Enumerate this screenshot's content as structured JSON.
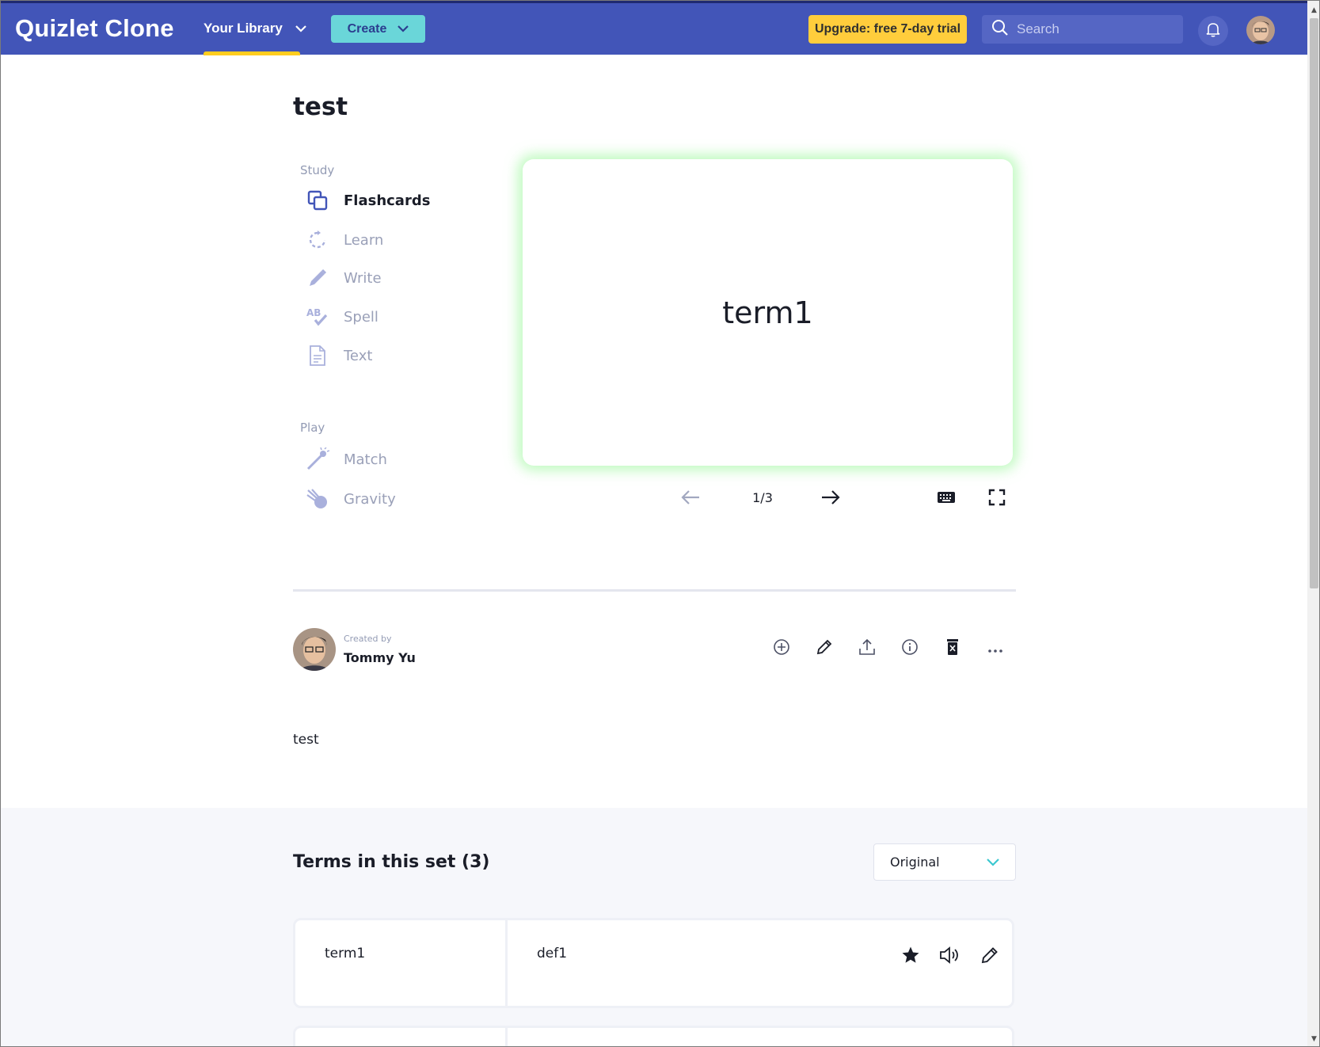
{
  "nav": {
    "logo": "Quizlet Clone",
    "library_label": "Your Library",
    "create_label": "Create",
    "upgrade_label": "Upgrade: free 7-day trial",
    "search_placeholder": "Search"
  },
  "set": {
    "title": "test",
    "description": "test"
  },
  "study": {
    "section_label": "Study",
    "items": [
      {
        "label": "Flashcards",
        "icon": "flashcards-icon",
        "active": true
      },
      {
        "label": "Learn",
        "icon": "learn-icon"
      },
      {
        "label": "Write",
        "icon": "pencil-icon"
      },
      {
        "label": "Spell",
        "icon": "spell-icon"
      },
      {
        "label": "Text",
        "icon": "document-icon"
      }
    ]
  },
  "play": {
    "section_label": "Play",
    "items": [
      {
        "label": "Match",
        "icon": "match-icon"
      },
      {
        "label": "Gravity",
        "icon": "gravity-icon"
      }
    ]
  },
  "flashcard": {
    "term": "term1",
    "counter": "1/3"
  },
  "creator": {
    "created_by_label": "Created by",
    "name": "Tommy Yu"
  },
  "terms": {
    "heading": "Terms in this set (3)",
    "sort_selected": "Original",
    "rows": [
      {
        "term": "term1",
        "definition": "def1"
      },
      {
        "term": "",
        "definition": ""
      }
    ]
  },
  "colors": {
    "nav_bg": "#4255b8",
    "create_bg": "#6ad6d9",
    "upgrade_bg": "#ffcd3c",
    "accent_underline": "#ffcd1f",
    "card_glow": "#8cf58c"
  }
}
